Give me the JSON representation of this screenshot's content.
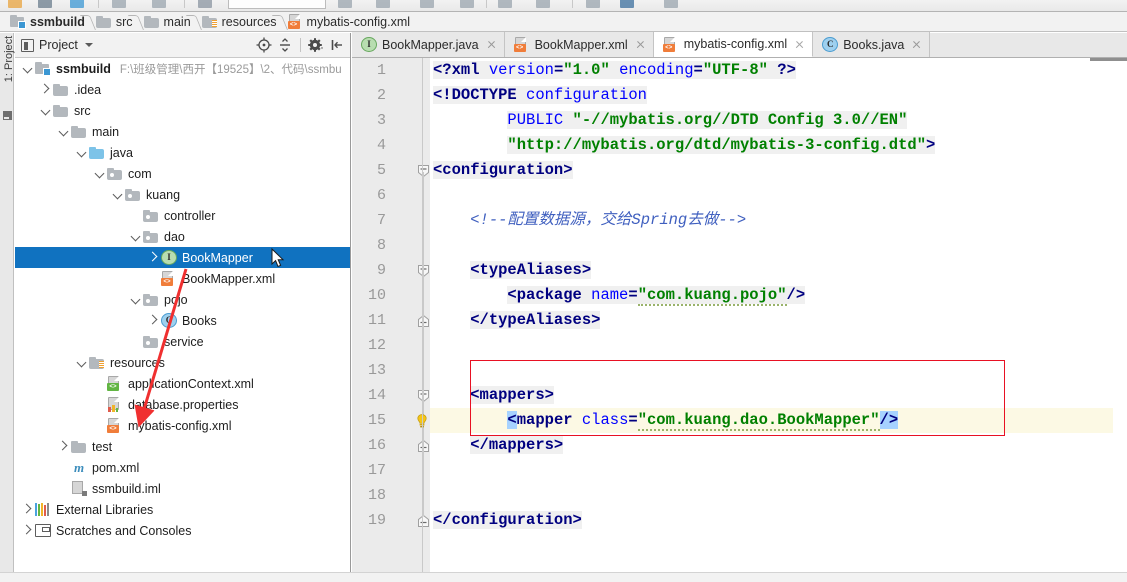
{
  "window": {
    "breadcrumbs": [
      {
        "label": "ssmbuild",
        "icon": "module-folder-icon"
      },
      {
        "label": "src",
        "icon": "folder-icon"
      },
      {
        "label": "main",
        "icon": "folder-icon"
      },
      {
        "label": "resources",
        "icon": "resources-folder-icon"
      },
      {
        "label": "mybatis-config.xml",
        "icon": "xml-file-icon"
      }
    ]
  },
  "tool_window": {
    "vertical_label": "1: Project",
    "title": "Project",
    "tools": [
      {
        "name": "locate-in-tree-icon"
      },
      {
        "name": "collapse-all-icon"
      },
      {
        "name": "settings-gear-icon"
      },
      {
        "name": "hide-panel-icon"
      }
    ]
  },
  "tree": {
    "items": [
      {
        "label": "ssmbuild",
        "path": "F:\\班级管理\\西开【19525】\\2、代码\\ssmbu",
        "indent": 0,
        "twist": "expanded",
        "icon": "module-folder-icon",
        "bold": true,
        "selected": false
      },
      {
        "label": ".idea",
        "path": "",
        "indent": 1,
        "twist": "collapsed",
        "icon": "folder-icon",
        "bold": false,
        "selected": false
      },
      {
        "label": "src",
        "path": "",
        "indent": 1,
        "twist": "expanded",
        "icon": "folder-icon",
        "bold": false,
        "selected": false
      },
      {
        "label": "main",
        "path": "",
        "indent": 2,
        "twist": "expanded",
        "icon": "folder-icon",
        "bold": false,
        "selected": false
      },
      {
        "label": "java",
        "path": "",
        "indent": 3,
        "twist": "expanded",
        "icon": "java-source-folder-icon",
        "bold": false,
        "selected": false
      },
      {
        "label": "com",
        "path": "",
        "indent": 4,
        "twist": "expanded",
        "icon": "package-icon",
        "bold": false,
        "selected": false
      },
      {
        "label": "kuang",
        "path": "",
        "indent": 5,
        "twist": "expanded",
        "icon": "package-icon",
        "bold": false,
        "selected": false
      },
      {
        "label": "controller",
        "path": "",
        "indent": 6,
        "twist": "none",
        "icon": "package-icon",
        "bold": false,
        "selected": false
      },
      {
        "label": "dao",
        "path": "",
        "indent": 6,
        "twist": "expanded",
        "icon": "package-icon",
        "bold": false,
        "selected": false
      },
      {
        "label": "BookMapper",
        "path": "",
        "indent": 7,
        "twist": "collapsed",
        "icon": "interface-icon",
        "bold": false,
        "selected": true
      },
      {
        "label": "BookMapper.xml",
        "path": "",
        "indent": 7,
        "twist": "none",
        "icon": "xml-file-icon",
        "bold": false,
        "selected": false
      },
      {
        "label": "pojo",
        "path": "",
        "indent": 6,
        "twist": "expanded",
        "icon": "package-icon",
        "bold": false,
        "selected": false
      },
      {
        "label": "Books",
        "path": "",
        "indent": 7,
        "twist": "collapsed",
        "icon": "class-icon",
        "bold": false,
        "selected": false
      },
      {
        "label": "service",
        "path": "",
        "indent": 6,
        "twist": "none",
        "icon": "package-icon",
        "bold": false,
        "selected": false
      },
      {
        "label": "resources",
        "path": "",
        "indent": 3,
        "twist": "expanded",
        "icon": "resources-folder-icon",
        "bold": false,
        "selected": false
      },
      {
        "label": "applicationContext.xml",
        "path": "",
        "indent": 4,
        "twist": "none",
        "icon": "spring-xml-file-icon",
        "bold": false,
        "selected": false
      },
      {
        "label": "database.properties",
        "path": "",
        "indent": 4,
        "twist": "none",
        "icon": "properties-file-icon",
        "bold": false,
        "selected": false
      },
      {
        "label": "mybatis-config.xml",
        "path": "",
        "indent": 4,
        "twist": "none",
        "icon": "xml-file-icon",
        "bold": false,
        "selected": false
      },
      {
        "label": "test",
        "path": "",
        "indent": 2,
        "twist": "collapsed",
        "icon": "test-folder-icon",
        "bold": false,
        "selected": false
      },
      {
        "label": "pom.xml",
        "path": "",
        "indent": 2,
        "twist": "none",
        "icon": "maven-icon",
        "bold": false,
        "selected": false
      },
      {
        "label": "ssmbuild.iml",
        "path": "",
        "indent": 2,
        "twist": "none",
        "icon": "iml-file-icon",
        "bold": false,
        "selected": false
      },
      {
        "label": "External Libraries",
        "path": "",
        "indent": 0,
        "twist": "collapsed",
        "icon": "libraries-icon",
        "bold": false,
        "selected": false
      },
      {
        "label": "Scratches and Consoles",
        "path": "",
        "indent": 0,
        "twist": "collapsed",
        "icon": "scratches-icon",
        "bold": false,
        "selected": false
      }
    ]
  },
  "editor": {
    "tabs": [
      {
        "label": "BookMapper.java",
        "icon": "interface-icon",
        "active": false
      },
      {
        "label": "BookMapper.xml",
        "icon": "xml-file-icon",
        "active": false
      },
      {
        "label": "mybatis-config.xml",
        "icon": "xml-file-icon",
        "active": true
      },
      {
        "label": "Books.java",
        "icon": "class-icon",
        "active": false
      }
    ],
    "caret_line": 15,
    "line_numbers": [
      1,
      2,
      3,
      4,
      5,
      6,
      7,
      8,
      9,
      10,
      11,
      12,
      13,
      14,
      15,
      16,
      17,
      18,
      19
    ],
    "lines": [
      {
        "n": 1,
        "text": "<?xml version=\"1.0\" encoding=\"UTF-8\" ?>"
      },
      {
        "n": 2,
        "text": "<!DOCTYPE configuration"
      },
      {
        "n": 3,
        "text": "        PUBLIC \"-//mybatis.org//DTD Config 3.0//EN\""
      },
      {
        "n": 4,
        "text": "        \"http://mybatis.org/dtd/mybatis-3-config.dtd\">"
      },
      {
        "n": 5,
        "text": "<configuration>"
      },
      {
        "n": 6,
        "text": ""
      },
      {
        "n": 7,
        "text": "    <!--配置数据源，交给Spring去做-->"
      },
      {
        "n": 8,
        "text": ""
      },
      {
        "n": 9,
        "text": "    <typeAliases>"
      },
      {
        "n": 10,
        "text": "        <package name=\"com.kuang.pojo\"/>"
      },
      {
        "n": 11,
        "text": "    </typeAliases>"
      },
      {
        "n": 12,
        "text": ""
      },
      {
        "n": 13,
        "text": ""
      },
      {
        "n": 14,
        "text": "    <mappers>"
      },
      {
        "n": 15,
        "text": "        <mapper class=\"com.kuang.dao.BookMapper\"/>"
      },
      {
        "n": 16,
        "text": "    </mappers>"
      },
      {
        "n": 17,
        "text": ""
      },
      {
        "n": 18,
        "text": ""
      },
      {
        "n": 19,
        "text": "</configuration>"
      }
    ],
    "gutter_icons": [
      {
        "line": 15,
        "name": "intention-bulb-icon"
      }
    ],
    "annotation": {
      "name": "red-highlight-box",
      "target_lines": "14-16"
    }
  },
  "colors": {
    "selection_blue": "#1072c0",
    "annotation_red": "#e81123",
    "tag": "#000080",
    "attribute": "#0000ff",
    "value": "#008000",
    "comment": "#3f5fbf",
    "caret_line": "#fcf9e4"
  }
}
